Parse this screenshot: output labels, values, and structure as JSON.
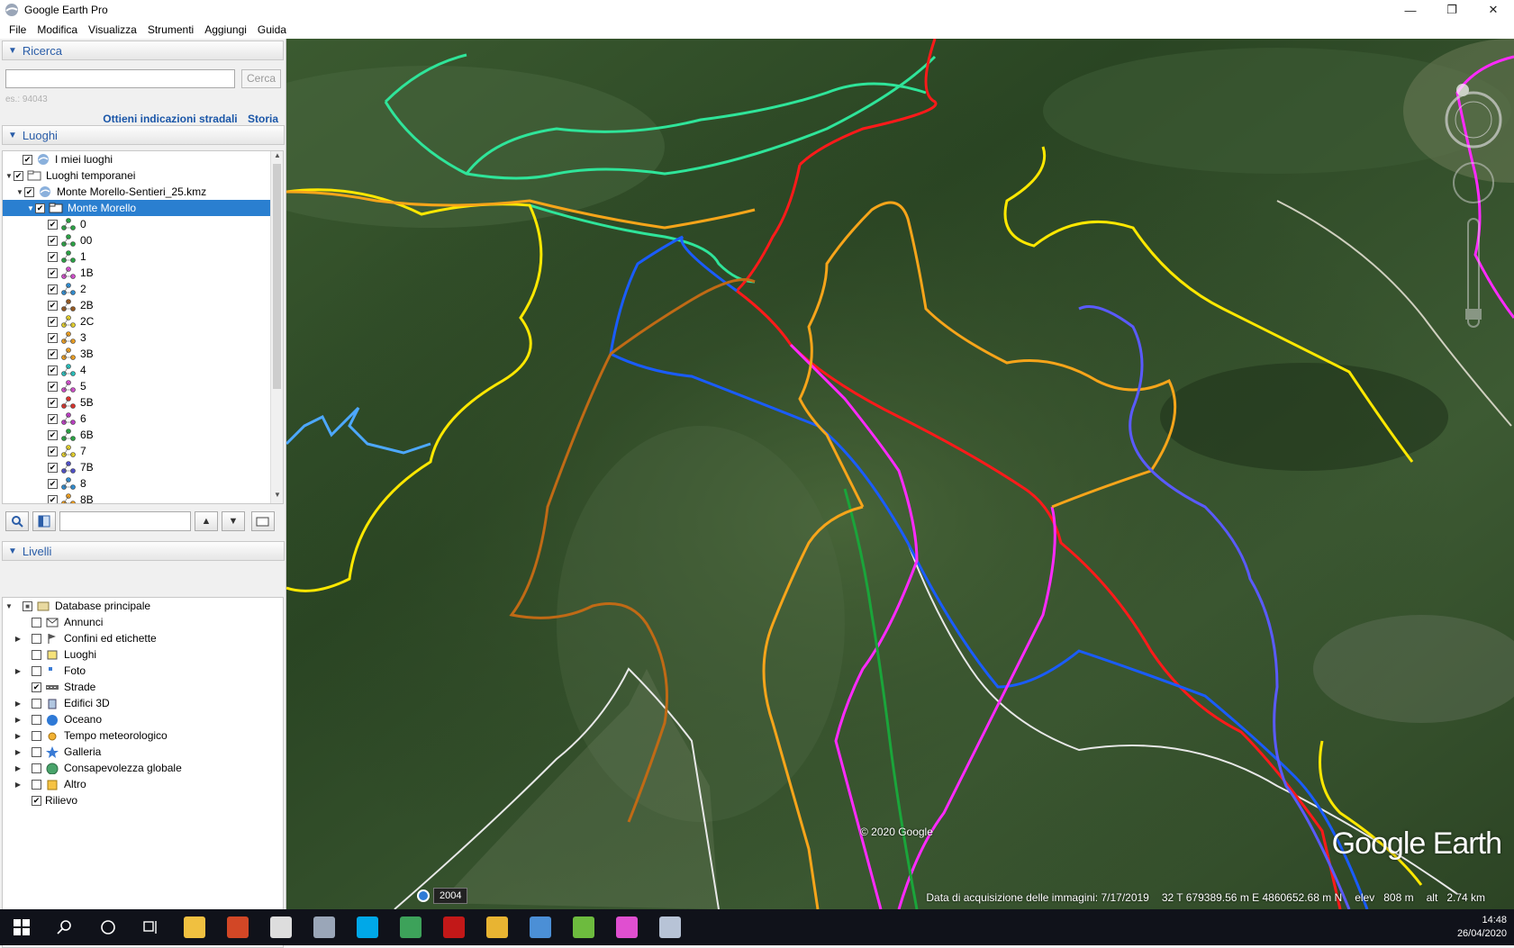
{
  "window": {
    "title": "Google Earth Pro",
    "min": "—",
    "max": "❐",
    "close": "✕"
  },
  "menu": [
    "File",
    "Modifica",
    "Visualizza",
    "Strumenti",
    "Aggiungi",
    "Guida"
  ],
  "search": {
    "header": "Ricerca",
    "placeholder": "",
    "button": "Cerca",
    "hint": "es.: 94043",
    "link_directions": "Ottieni indicazioni stradali",
    "link_history": "Storia"
  },
  "places": {
    "header": "Luoghi",
    "my_places": "I miei luoghi",
    "temp_places": "Luoghi temporanei",
    "kmz": "Monte Morello-Sentieri_25.kmz",
    "folder": "Monte Morello",
    "trails": [
      {
        "label": "0",
        "color": "#27a843"
      },
      {
        "label": "00",
        "color": "#27a843"
      },
      {
        "label": "1",
        "color": "#27a843"
      },
      {
        "label": "1B",
        "color": "#d64fd0"
      },
      {
        "label": "2",
        "color": "#2f8fd6"
      },
      {
        "label": "2B",
        "color": "#9a5a1e"
      },
      {
        "label": "2C",
        "color": "#e8d32a"
      },
      {
        "label": "3",
        "color": "#f0a020"
      },
      {
        "label": "3B",
        "color": "#f0a020"
      },
      {
        "label": "4",
        "color": "#27c4c0"
      },
      {
        "label": "5",
        "color": "#d64fd0"
      },
      {
        "label": "5B",
        "color": "#e0312a"
      },
      {
        "label": "6",
        "color": "#c03cc8"
      },
      {
        "label": "6B",
        "color": "#27a843"
      },
      {
        "label": "7",
        "color": "#e8d32a"
      },
      {
        "label": "7B",
        "color": "#5050d0"
      },
      {
        "label": "8",
        "color": "#2f8fd6"
      },
      {
        "label": "8B",
        "color": "#f0a020"
      }
    ]
  },
  "layers": {
    "header": "Livelli",
    "items": [
      {
        "label": "Database principale",
        "checked": "partial",
        "expand": "▼",
        "icon": "database-icon"
      },
      {
        "label": "Annunci",
        "checked": "off",
        "expand": "",
        "icon": "mail-icon"
      },
      {
        "label": "Confini ed etichette",
        "checked": "off",
        "expand": "▶",
        "icon": "flag-icon"
      },
      {
        "label": "Luoghi",
        "checked": "off",
        "expand": "",
        "icon": "place-icon"
      },
      {
        "label": "Foto",
        "checked": "off",
        "expand": "▶",
        "icon": "photo-icon"
      },
      {
        "label": "Strade",
        "checked": "on",
        "expand": "",
        "icon": "road-icon"
      },
      {
        "label": "Edifici 3D",
        "checked": "off",
        "expand": "▶",
        "icon": "building-icon"
      },
      {
        "label": "Oceano",
        "checked": "off",
        "expand": "▶",
        "icon": "ocean-icon"
      },
      {
        "label": "Tempo meteorologico",
        "checked": "off",
        "expand": "▶",
        "icon": "weather-icon"
      },
      {
        "label": "Galleria",
        "checked": "off",
        "expand": "▶",
        "icon": "gallery-icon"
      },
      {
        "label": "Consapevolezza globale",
        "checked": "off",
        "expand": "▶",
        "icon": "globe-icon"
      },
      {
        "label": "Altro",
        "checked": "off",
        "expand": "▶",
        "icon": "other-icon"
      },
      {
        "label": "Rilievo",
        "checked": "on",
        "expand": "",
        "icon": "terrain-icon"
      }
    ]
  },
  "map": {
    "copyright": "© 2020 Google",
    "logo": "Google Earth",
    "year": "2004",
    "acq_date": "Data di acquisizione delle immagini: 7/17/2019",
    "coords": "32 T 679389.56 m E 4860652.68 m N",
    "elev_label": "elev",
    "elev": "808 m",
    "alt_label": "alt",
    "alt": "2.74 km"
  },
  "taskbar": {
    "time": "14:48",
    "date": "26/04/2020",
    "apps": [
      {
        "name": "start-icon",
        "color": "#ffffff"
      },
      {
        "name": "search-icon",
        "color": "#ffffff"
      },
      {
        "name": "cortana-icon",
        "color": "#ffffff"
      },
      {
        "name": "taskview-icon",
        "color": "#ffffff"
      },
      {
        "name": "file-explorer-icon",
        "color": "#f0c040"
      },
      {
        "name": "powerpoint-icon",
        "color": "#d24726"
      },
      {
        "name": "calculator-icon",
        "color": "#dddddd"
      },
      {
        "name": "google-earth-icon",
        "color": "#9aa6b8"
      },
      {
        "name": "skype-icon",
        "color": "#00a8e8"
      },
      {
        "name": "excel-icon",
        "color": "#3da25a"
      },
      {
        "name": "filezilla-icon",
        "color": "#c21818"
      },
      {
        "name": "chrome-icon",
        "color": "#e8b432"
      },
      {
        "name": "app-icon",
        "color": "#4b8fd6"
      },
      {
        "name": "qgis-icon",
        "color": "#6dbb3e"
      },
      {
        "name": "paint-icon",
        "color": "#e04fd0"
      },
      {
        "name": "google-earth-pro-icon",
        "color": "#b7c3d6"
      }
    ]
  }
}
